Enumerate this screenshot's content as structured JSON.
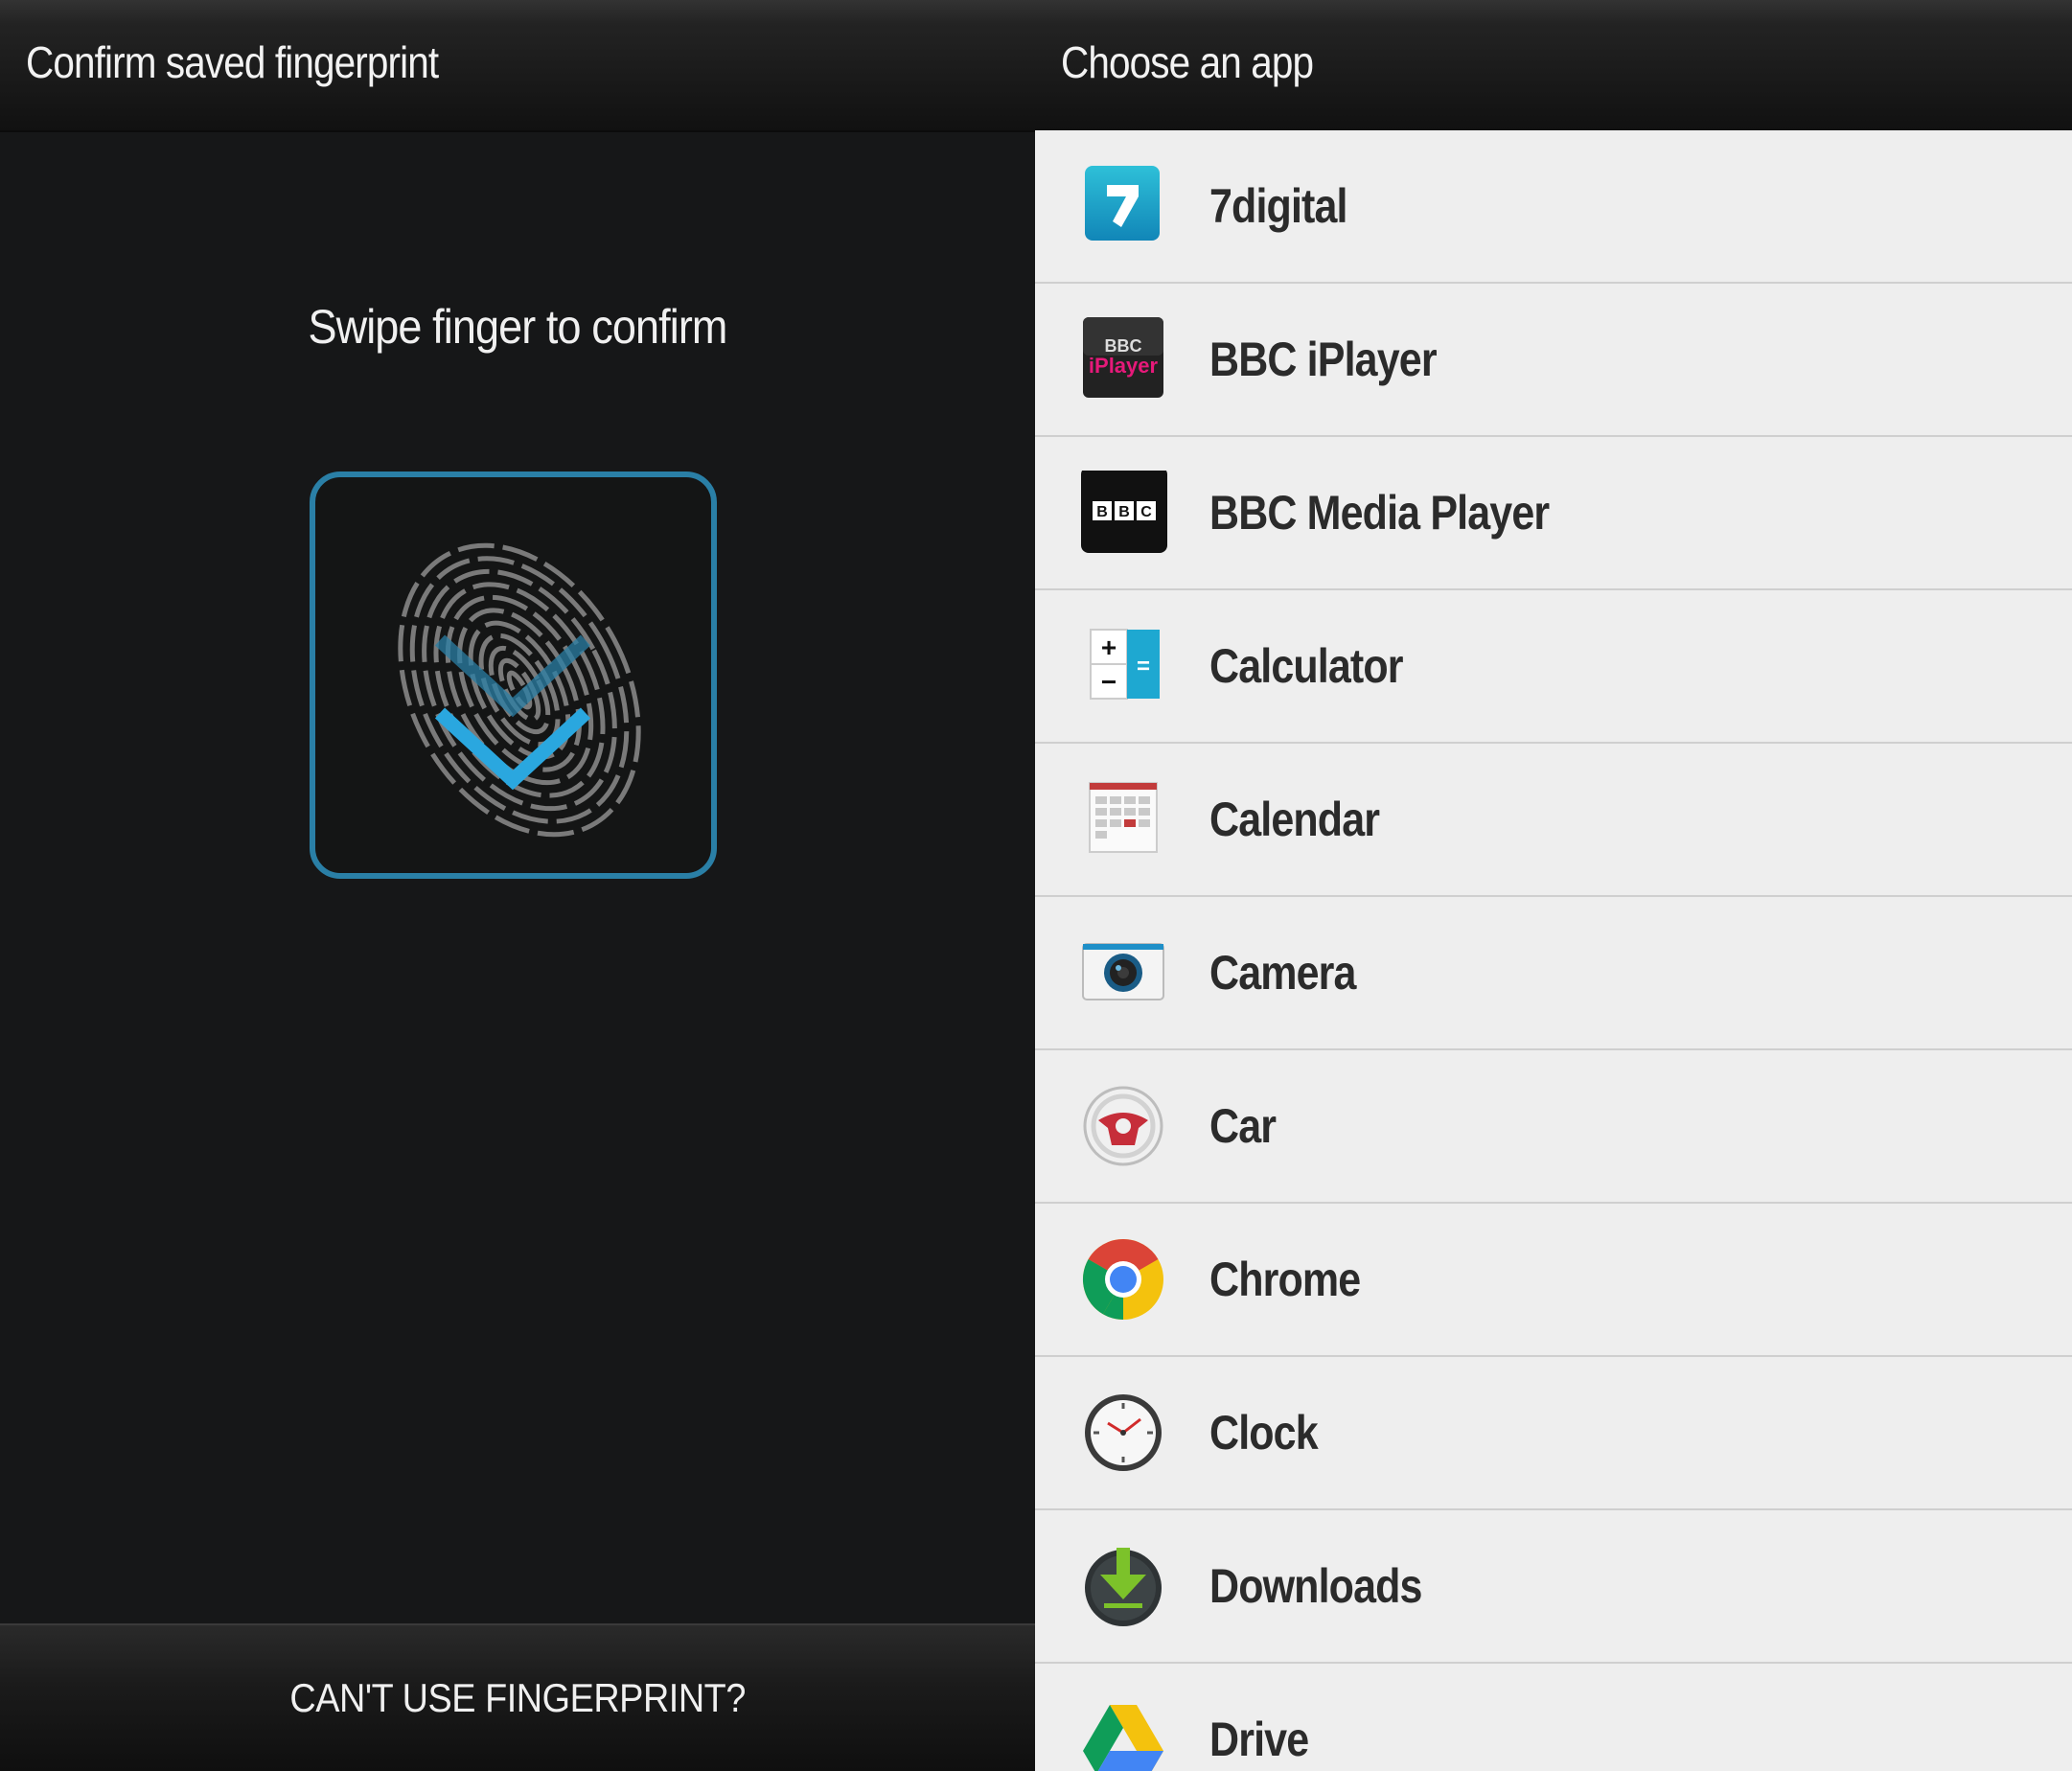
{
  "left_screen": {
    "title": "Confirm saved fingerprint",
    "prompt": "Swipe finger to confirm",
    "scanner_icon": "fingerprint-check-icon",
    "alternate_button": "CAN'T USE FINGERPRINT?",
    "accent_color": "#2a7fa6",
    "check_color": "#2aa7df"
  },
  "right_screen": {
    "title": "Choose an app",
    "apps": [
      {
        "label": "7digital",
        "icon": "7digital-icon"
      },
      {
        "label": "BBC iPlayer",
        "icon": "bbc-iplayer-icon",
        "icon_text_top": "BBC",
        "icon_text_bottom": "iPlayer"
      },
      {
        "label": "BBC Media Player",
        "icon": "bbc-media-player-icon",
        "icon_text": "BBC"
      },
      {
        "label": "Calculator",
        "icon": "calculator-icon",
        "icon_text_plus": "+",
        "icon_text_minus": "−",
        "icon_text_equals": "="
      },
      {
        "label": "Calendar",
        "icon": "calendar-icon"
      },
      {
        "label": "Camera",
        "icon": "camera-icon"
      },
      {
        "label": "Car",
        "icon": "car-steering-wheel-icon"
      },
      {
        "label": "Chrome",
        "icon": "chrome-icon"
      },
      {
        "label": "Clock",
        "icon": "clock-icon"
      },
      {
        "label": "Downloads",
        "icon": "downloads-icon"
      },
      {
        "label": "Drive",
        "icon": "drive-icon"
      }
    ]
  }
}
